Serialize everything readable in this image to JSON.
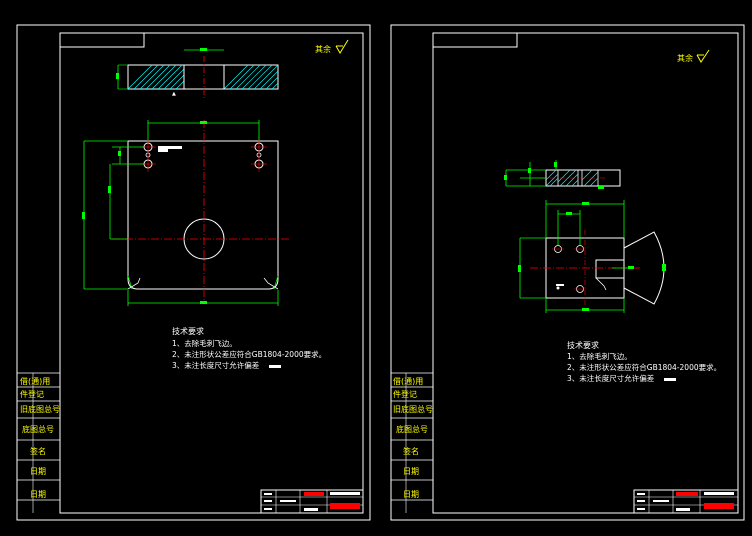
{
  "roughness_note": "其余",
  "tech_requirements": {
    "title": "技术要求",
    "items": [
      "1、去除毛刺飞边。",
      "2、未注形状公差应符合GB1804-2000要求。",
      "3、未注长度尺寸允许偏差"
    ]
  },
  "side_labels": [
    "借(通)用",
    "件登记",
    "旧底图总号",
    "底图总号",
    "签名",
    "日期",
    "日期"
  ],
  "colors": {
    "border": "#ffffff",
    "outline": "#ffffff",
    "dimension": "#00ff00",
    "centerline": "#ff0000",
    "hatch": "#00ffff",
    "text": "#ffffff",
    "label": "#ffff00",
    "block_red": "#ff0000"
  }
}
